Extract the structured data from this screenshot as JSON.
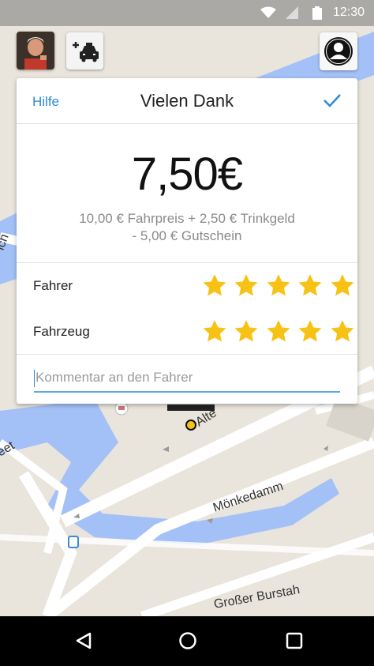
{
  "status_bar": {
    "time": "12:30"
  },
  "card": {
    "help_label": "Hilfe",
    "title": "Vielen Dank",
    "price": "7,50€",
    "breakdown_line1": "10,00 € Fahrpreis + 2,50 € Trinkgeld",
    "breakdown_line2": "- 5,00 € Gutschein",
    "ratings": [
      {
        "label": "Fahrer",
        "stars": 5
      },
      {
        "label": "Fahrzeug",
        "stars": 5
      }
    ],
    "comment_placeholder": "Kommentar an den Fahrer"
  },
  "map": {
    "labels": [
      "Mönkedamm",
      "Großer Burstah",
      "Alte",
      "eet",
      "ich"
    ]
  },
  "colors": {
    "accent": "#2a8ad6",
    "star": "#f7c213",
    "water": "#a4c1f7"
  },
  "icons": [
    "wifi-icon",
    "signal-icon",
    "battery-icon",
    "add-taxi-icon",
    "profile-icon",
    "checkmark-icon",
    "star-icon",
    "back-icon",
    "home-icon",
    "recents-icon",
    "hotel-icon",
    "bus-stop-icon",
    "location-marker-icon"
  ]
}
